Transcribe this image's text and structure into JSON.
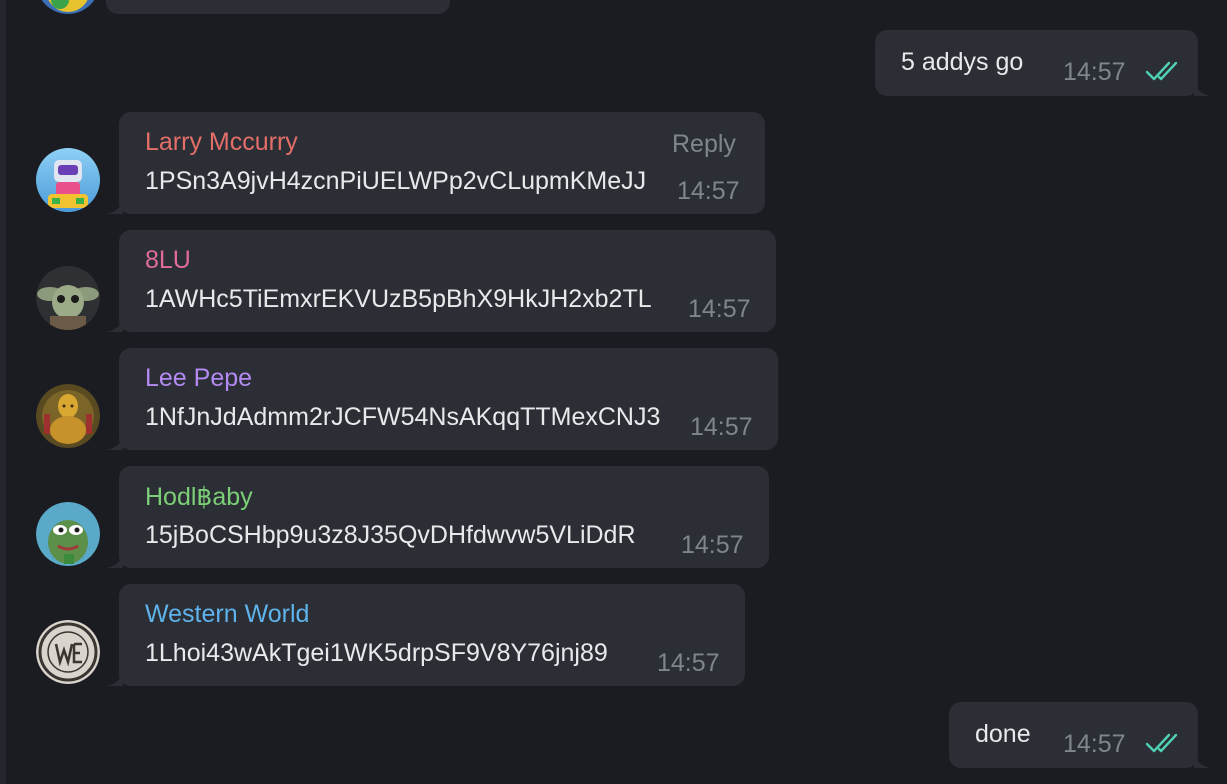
{
  "colors": {
    "background": "#1a1c21",
    "bubble": "#2b2e35",
    "timestamp": "#7f858d",
    "message_text": "#e8e9eb",
    "read_check": "#4fd1b5"
  },
  "outgoing": [
    {
      "text": "5 addys  go",
      "time": "14:57",
      "status_icon": "double-check-icon"
    },
    {
      "text": "done",
      "time": "14:57",
      "status_icon": "double-check-icon"
    }
  ],
  "incoming": [
    {
      "sender": "Larry Mccurry",
      "sender_color": "#e46e68",
      "text": "1PSn3A9jvH4zcnPiUELWPp2vCLupmKMeJJ",
      "time": "14:57",
      "action": "Reply",
      "avatar_icon": "robot-avatar-icon"
    },
    {
      "sender": "8LU",
      "sender_color": "#e06b9a",
      "text": "1AWHc5TiEmxrEKVUzB5pBhX9HkJH2xb2TL",
      "time": "14:57",
      "avatar_icon": "baby-yoda-avatar-icon"
    },
    {
      "sender": "Lee Pepe",
      "sender_color": "#b48af2",
      "text": "1NfJnJdAdmm2rJCFW54NsAKqqTTMexCNJ3",
      "time": "14:57",
      "avatar_icon": "golden-statue-avatar-icon"
    },
    {
      "sender": "Hodl฿aby",
      "sender_color": "#7ccf77",
      "text": "15jBoCSHbp9u3z8J35QvDHfdwvw5VLiDdR",
      "time": "14:57",
      "avatar_icon": "pepe-avatar-icon"
    },
    {
      "sender": "Western World",
      "sender_color": "#5fb3ec",
      "text": "1Lhoi43wAkTgei1WK5drpSF9V8Y76jnj89",
      "time": "14:57",
      "avatar_icon": "western-world-logo-avatar-icon"
    }
  ]
}
